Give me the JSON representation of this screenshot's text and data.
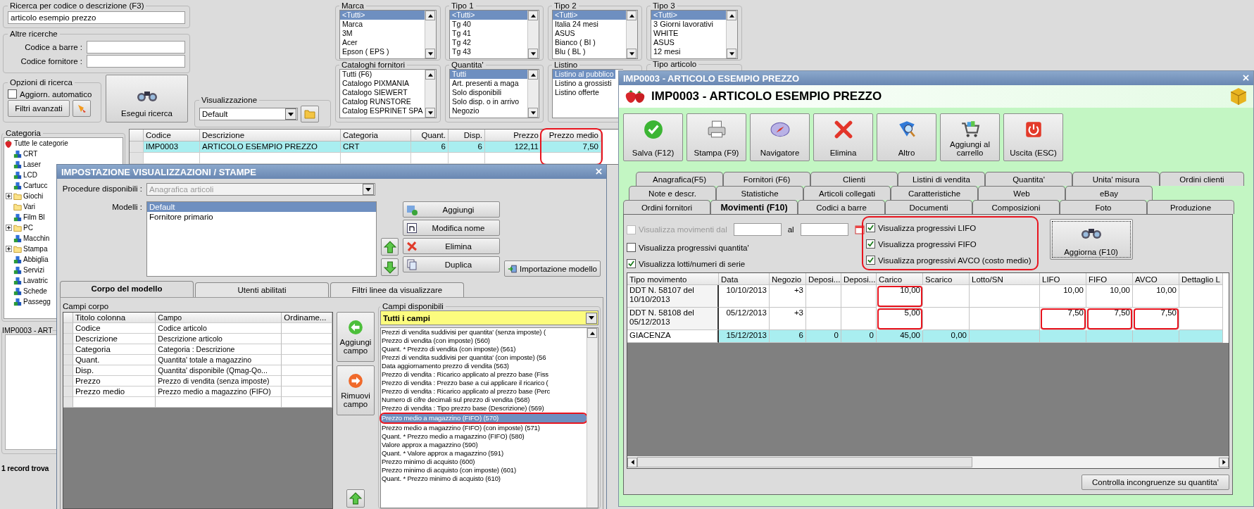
{
  "search": {
    "title": "Ricerca per codice o descrizione (F3)",
    "value": "articolo esempio prezzo"
  },
  "other_searches": {
    "title": "Altre ricerche",
    "fields": [
      {
        "label": "Codice a barre :"
      },
      {
        "label": "Codice fornitore :"
      }
    ]
  },
  "search_options": {
    "title": "Opzioni di ricerca",
    "auto_update": {
      "label": "Aggiorn. automatico",
      "checked": false
    },
    "advanced_filters": "Filtri avanzati"
  },
  "run_search": "Esegui ricerca",
  "view": {
    "title": "Visualizzazione",
    "value": "Default"
  },
  "filters": [
    {
      "title": "Marca",
      "items": [
        {
          "label": "<Tutti>",
          "selected": true
        },
        {
          "label": "Marca",
          "selected": false
        },
        {
          "label": "3M",
          "selected": false
        },
        {
          "label": "Acer",
          "selected": false
        },
        {
          "label": "Epson ( EPS )",
          "selected": false
        }
      ]
    },
    {
      "title": "Tipo 1",
      "items": [
        {
          "label": "<Tutti>",
          "selected": true
        },
        {
          "label": "Tg 40",
          "selected": false
        },
        {
          "label": "Tg 41",
          "selected": false
        },
        {
          "label": "Tg 42",
          "selected": false
        },
        {
          "label": "Tg 43",
          "selected": false
        }
      ]
    },
    {
      "title": "Tipo 2",
      "items": [
        {
          "label": "<Tutti>",
          "selected": true
        },
        {
          "label": "Italia 24 mesi",
          "selected": false
        },
        {
          "label": "ASUS",
          "selected": false
        },
        {
          "label": "Bianco ( BI )",
          "selected": false
        },
        {
          "label": "Blu ( BL )",
          "selected": false
        }
      ]
    },
    {
      "title": "Tipo 3",
      "items": [
        {
          "label": "<Tutti>",
          "selected": true
        },
        {
          "label": "3 Giorni lavorativi",
          "selected": false
        },
        {
          "label": "WHITE",
          "selected": false
        },
        {
          "label": "ASUS",
          "selected": false
        },
        {
          "label": "12 mesi",
          "selected": false
        }
      ]
    },
    {
      "title": "Cataloghi fornitori",
      "items": [
        {
          "label": "Tutti (F6)",
          "selected": false
        },
        {
          "label": "Catalogo PIXMANIA",
          "selected": false
        },
        {
          "label": "Catalogo SIEWERT",
          "selected": false
        },
        {
          "label": "Catalog RUNSTORE",
          "selected": false
        },
        {
          "label": "Catalog ESPRINET SPA",
          "selected": false
        }
      ]
    },
    {
      "title": "Quantita'",
      "items": [
        {
          "label": "Tutti",
          "selected": true
        },
        {
          "label": "Art. presenti a maga",
          "selected": false
        },
        {
          "label": "Solo disponibili",
          "selected": false
        },
        {
          "label": "Solo disp. o in arrivo",
          "selected": false
        },
        {
          "label": "Negozio",
          "selected": false
        }
      ]
    },
    {
      "title": "Listino",
      "items": [
        {
          "label": "Listino al pubblico",
          "selected": true
        },
        {
          "label": "Listino a grossisti",
          "selected": false
        },
        {
          "label": "Listino offerte",
          "selected": false
        }
      ]
    },
    {
      "title": "Tipo articolo"
    }
  ],
  "category": {
    "title": "Categoria",
    "tree": [
      {
        "label": "Tutte le categorie",
        "kind": "root",
        "children": [
          {
            "label": "CRT",
            "kind": "leaf"
          },
          {
            "label": "Laser",
            "kind": "leaf"
          },
          {
            "label": "LCD",
            "kind": "leaf"
          },
          {
            "label": "Cartucc",
            "kind": "leaf"
          },
          {
            "label": "Giochi",
            "kind": "folder",
            "expanded": false
          },
          {
            "label": "Vari",
            "kind": "folder"
          },
          {
            "label": "Film Bl",
            "kind": "leaf"
          },
          {
            "label": "PC",
            "kind": "folder",
            "expanded": false
          },
          {
            "label": "Macchin",
            "kind": "leaf"
          },
          {
            "label": "Stampa",
            "kind": "folder",
            "expanded": false
          },
          {
            "label": "Abbiglia",
            "kind": "leaf"
          },
          {
            "label": "Servizi",
            "kind": "leaf"
          },
          {
            "label": "Lavatric",
            "kind": "leaf"
          },
          {
            "label": "Schede",
            "kind": "leaf"
          },
          {
            "label": "Passegg",
            "kind": "leaf"
          }
        ]
      }
    ]
  },
  "detail_group": {
    "title": "IMP0003 - ART"
  },
  "record_count": "1 record trova",
  "results": {
    "columns": [
      {
        "label": "Codice",
        "kind": "text",
        "highlighted": false
      },
      {
        "label": "Descrizione",
        "kind": "text",
        "highlighted": false
      },
      {
        "label": "Categoria",
        "kind": "text",
        "highlighted": false
      },
      {
        "label": "Quant.",
        "kind": "number",
        "highlighted": false
      },
      {
        "label": "Disp.",
        "kind": "number",
        "highlighted": false
      },
      {
        "label": "Prezzo",
        "kind": "number",
        "highlighted": false
      },
      {
        "label": "Prezzo medio",
        "kind": "number",
        "highlighted": true
      }
    ],
    "rows": [
      {
        "selected": true,
        "cells": [
          "IMP0003",
          "ARTICOLO ESEMPIO PREZZO",
          "CRT",
          "6",
          "6",
          "122,11",
          "7,50"
        ]
      }
    ]
  },
  "dialog": {
    "title": "IMPOSTAZIONE VISUALIZZAZIONI / STAMPE",
    "procedure": {
      "label": "Procedure disponibili :",
      "value": "Anagrafica articoli",
      "disabled": true
    },
    "models": {
      "label": "Modelli :",
      "items": [
        {
          "label": "Default",
          "selected": true
        },
        {
          "label": "Fornitore primario",
          "selected": false
        }
      ]
    },
    "model_buttons": [
      "Aggiungi",
      "Modifica nome",
      "Elimina",
      "Duplica"
    ],
    "import_button": "Importazione modello",
    "tabs": [
      {
        "label": "Corpo del modello",
        "selected": true
      },
      {
        "label": "Utenti abilitati",
        "selected": false
      },
      {
        "label": "Filtri linee da visualizzare",
        "selected": false
      }
    ],
    "body_fields": {
      "title": "Campi corpo",
      "columns": [
        "Titolo colonna",
        "Campo",
        "Ordiname..."
      ],
      "rows": [
        [
          "Codice",
          "Codice articolo"
        ],
        [
          "Descrizione",
          "Descrizione articolo"
        ],
        [
          "Categoria",
          "Categoria : Descrizione"
        ],
        [
          "Quant.",
          "Quantita' totale a magazzino"
        ],
        [
          "Disp.",
          "Quantita' disponibile (Qmag-Qo..."
        ],
        [
          "Prezzo",
          "Prezzo di vendita (senza imposte)"
        ],
        [
          "Prezzo medio",
          "Prezzo medio a magazzino (FIFO)"
        ]
      ]
    },
    "add_field": "Aggiungi campo",
    "remove_field": "Rimuovi campo",
    "available": {
      "title": "Campi disponibili",
      "filter": "Tutti i campi",
      "items": [
        {
          "label": "Prezzi di vendita suddivisi per quantita' (senza imposte) (",
          "selected": false,
          "highlighted": false
        },
        {
          "label": "Prezzo di vendita (con imposte) (560)",
          "selected": false,
          "highlighted": false
        },
        {
          "label": "Quant. * Prezzo di vendita (con imposte) (561)",
          "selected": false,
          "highlighted": false
        },
        {
          "label": "Prezzi di vendita suddivisi per quantita' (con imposte) (56",
          "selected": false,
          "highlighted": false
        },
        {
          "label": "Data aggiornamento prezzo di vendita (563)",
          "selected": false,
          "highlighted": false
        },
        {
          "label": "Prezzo di vendita : Ricarico applicato al prezzo base (Fiss",
          "selected": false,
          "highlighted": false
        },
        {
          "label": "Prezzo di vendita : Prezzo base a cui applicare il ricarico (",
          "selected": false,
          "highlighted": false
        },
        {
          "label": "Prezzo di vendita : Ricarico applicato al prezzo base (Perc",
          "selected": false,
          "highlighted": false
        },
        {
          "label": "Numero di cifre decimali sul prezzo di vendita (568)",
          "selected": false,
          "highlighted": false
        },
        {
          "label": "Prezzo di vendita : Tipo prezzo base (Descrizione) (569)",
          "selected": false,
          "highlighted": false
        },
        {
          "label": "Prezzo medio a magazzino (FIFO) (570)",
          "selected": true,
          "highlighted": true
        },
        {
          "label": "Prezzo medio a magazzino (FIFO) (con imposte) (571)",
          "selected": false,
          "highlighted": false
        },
        {
          "label": "Quant. * Prezzo medio a magazzino (FIFO) (580)",
          "selected": false,
          "highlighted": false
        },
        {
          "label": "Valore approx a magazzino (590)",
          "selected": false,
          "highlighted": false
        },
        {
          "label": "Quant. * Valore approx a magazzino (591)",
          "selected": false,
          "highlighted": false
        },
        {
          "label": "Prezzo minimo di acquisto (600)",
          "selected": false,
          "highlighted": false
        },
        {
          "label": "Prezzo minimo di acquisto (con imposte) (601)",
          "selected": false,
          "highlighted": false
        },
        {
          "label": "Quant. * Prezzo minimo di acquisto (610)",
          "selected": false,
          "highlighted": false
        }
      ]
    }
  },
  "article": {
    "window_title": "IMP0003 - ARTICOLO ESEMPIO PREZZO",
    "heading": "IMP0003 - ARTICOLO ESEMPIO PREZZO",
    "toolbar": [
      "Salva (F12)",
      "Stampa (F9)",
      "Navigatore",
      "Elimina",
      "Altro",
      "Aggiungi al carrello",
      "Uscita (ESC)"
    ],
    "tab_rows": [
      [
        {
          "label": "Anagrafica(F5)",
          "selected": false
        },
        {
          "label": "Fornitori (F6)",
          "selected": false
        },
        {
          "label": "Clienti",
          "selected": false
        },
        {
          "label": "Listini di vendita",
          "selected": false
        },
        {
          "label": "Quantita'",
          "selected": false
        },
        {
          "label": "Unita' misura",
          "selected": false
        },
        {
          "label": "Ordini clienti",
          "selected": false
        }
      ],
      [
        {
          "label": "Note e descr.",
          "selected": false
        },
        {
          "label": "Statistiche",
          "selected": false
        },
        {
          "label": "Articoli collegati",
          "selected": false
        },
        {
          "label": "Caratteristiche",
          "selected": false
        },
        {
          "label": "Web",
          "selected": false
        },
        {
          "label": "eBay",
          "selected": false
        }
      ],
      [
        {
          "label": "Ordini fornitori",
          "selected": false
        },
        {
          "label": "Movimenti (F10)",
          "selected": true
        },
        {
          "label": "Codici a barre",
          "selected": false
        },
        {
          "label": "Documenti",
          "selected": false
        },
        {
          "label": "Composizioni",
          "selected": false
        },
        {
          "label": "Foto",
          "selected": false
        },
        {
          "label": "Produzione",
          "selected": false
        }
      ]
    ],
    "movements": {
      "date_filter": {
        "label": "Visualizza movimenti dal",
        "checked": false,
        "disabled": true,
        "to_label": "al"
      },
      "options": [
        {
          "label": "Visualizza progressivi quantita'",
          "checked": false
        },
        {
          "label": "Visualizza lotti/numeri di serie",
          "checked": true
        }
      ],
      "progressive": {
        "highlighted": true,
        "options": [
          {
            "label": "Visualizza progressivi LIFO",
            "checked": true
          },
          {
            "label": "Visualizza progressivi FIFO",
            "checked": true
          },
          {
            "label": "Visualizza progressivi AVCO (costo medio)",
            "checked": true
          }
        ]
      },
      "refresh": "Aggiorna (F10)",
      "table": {
        "columns": [
          {
            "label": "Tipo movimento",
            "kind": "text"
          },
          {
            "label": "Data",
            "kind": "number"
          },
          {
            "label": "Negozio",
            "kind": "number"
          },
          {
            "label": "Deposi...",
            "kind": "number"
          },
          {
            "label": "Deposi...",
            "kind": "number"
          },
          {
            "label": "Carico",
            "kind": "number"
          },
          {
            "label": "Scarico",
            "kind": "number"
          },
          {
            "label": "Lotto/SN",
            "kind": "text"
          },
          {
            "label": "LIFO",
            "kind": "number"
          },
          {
            "label": "FIFO",
            "kind": "number"
          },
          {
            "label": "AVCO",
            "kind": "number"
          },
          {
            "label": "Dettaglio L",
            "kind": "text"
          }
        ],
        "rows": [
          {
            "kind": "movement",
            "cells": [
              "DDT N. 58107 del 10/10/2013",
              "10/10/2013",
              "+3",
              null,
              null,
              {
                "text": "10,00",
                "highlighted": true
              },
              null,
              null,
              "10,00",
              "10,00",
              "10,00",
              null
            ]
          },
          {
            "kind": "movement",
            "cells": [
              "DDT N. 58108 del 05/12/2013",
              "05/12/2013",
              "+3",
              null,
              null,
              {
                "text": "5,00",
                "highlighted": true
              },
              null,
              null,
              {
                "text": "7,50",
                "highlighted": true
              },
              {
                "text": "7,50",
                "highlighted": true
              },
              {
                "text": "7,50",
                "highlighted": true
              },
              null
            ]
          },
          {
            "kind": "total",
            "cells": [
              "GIACENZA",
              "15/12/2013",
              "6",
              "0",
              "0",
              "45,00",
              "0,00",
              null,
              null,
              null,
              null,
              null
            ]
          }
        ]
      },
      "check_button": "Controlla incongruenze su quantita'"
    }
  }
}
